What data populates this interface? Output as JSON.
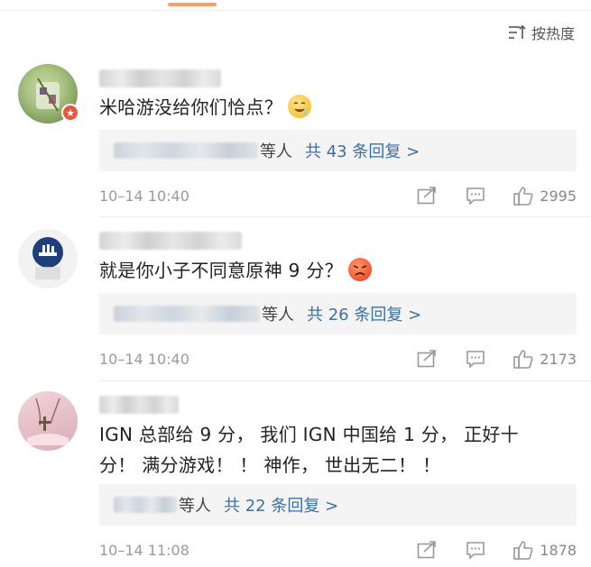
{
  "sort": {
    "label": "按热度"
  },
  "comments": [
    {
      "text": "米哈游没给你们恰点？",
      "emoji": "drooling-face-emoji",
      "replies_suffix": "等人",
      "replies_link": "共 43 条回复 >",
      "time": "10–14 10:40",
      "likes": "2995"
    },
    {
      "text": "就是你小子不同意原神 9 分？",
      "emoji": "angry-face-emoji",
      "replies_suffix": "等人",
      "replies_link": "共 26 条回复 >",
      "time": "10–14 10:40",
      "likes": "2173"
    },
    {
      "text_line1": "IGN 总部给 9 分， 我们 IGN 中国给 1 分， 正好十",
      "text_line2": "分！ 满分游戏！ ！ 神作， 世出无二！ ！",
      "replies_suffix": "等人",
      "replies_link": "共 22 条回复 >",
      "time": "10–14 11:08",
      "likes": "1878"
    }
  ],
  "colors": {
    "accent_link": "#3d6fa5",
    "tab_indicator": "#f5a06a",
    "badge": "#e8563e"
  }
}
